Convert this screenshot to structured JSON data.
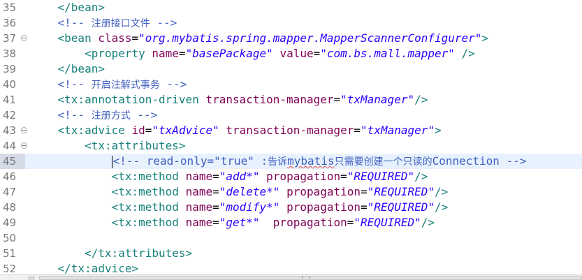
{
  "editor": {
    "lines": [
      {
        "num": "35",
        "fold": false,
        "current": false,
        "indent": "    ",
        "tokens": [
          {
            "c": "tag",
            "t": "</bean>"
          }
        ]
      },
      {
        "num": "36",
        "fold": false,
        "current": false,
        "indent": "    ",
        "tokens": [
          {
            "c": "comment",
            "t": "<!-- "
          },
          {
            "c": "comment-cjk",
            "t": "注册接口文件"
          },
          {
            "c": "comment",
            "t": " -->"
          }
        ]
      },
      {
        "num": "37",
        "fold": true,
        "current": false,
        "indent": "    ",
        "tokens": [
          {
            "c": "tag",
            "t": "<bean "
          },
          {
            "c": "attr",
            "t": "class"
          },
          {
            "c": "text",
            "t": "="
          },
          {
            "c": "val",
            "t": "\"org.mybatis.spring.mapper.MapperScannerConfigurer\""
          },
          {
            "c": "tag",
            "t": ">"
          }
        ]
      },
      {
        "num": "38",
        "fold": false,
        "current": false,
        "indent": "        ",
        "tokens": [
          {
            "c": "tag",
            "t": "<property "
          },
          {
            "c": "attr",
            "t": "name"
          },
          {
            "c": "text",
            "t": "="
          },
          {
            "c": "val",
            "t": "\"basePackage\""
          },
          {
            "c": "text",
            "t": " "
          },
          {
            "c": "attr",
            "t": "value"
          },
          {
            "c": "text",
            "t": "="
          },
          {
            "c": "val",
            "t": "\"com.bs.mall.mapper\""
          },
          {
            "c": "tag",
            "t": " />"
          }
        ]
      },
      {
        "num": "39",
        "fold": false,
        "current": false,
        "indent": "    ",
        "tokens": [
          {
            "c": "tag",
            "t": "</bean>"
          }
        ]
      },
      {
        "num": "40",
        "fold": false,
        "current": false,
        "indent": "    ",
        "tokens": [
          {
            "c": "comment",
            "t": "<!-- "
          },
          {
            "c": "comment-cjk",
            "t": "开启注解式事务"
          },
          {
            "c": "comment",
            "t": " -->"
          }
        ]
      },
      {
        "num": "41",
        "fold": false,
        "current": false,
        "indent": "    ",
        "tokens": [
          {
            "c": "tag",
            "t": "<tx:annotation-driven "
          },
          {
            "c": "attr",
            "t": "transaction-manager"
          },
          {
            "c": "text",
            "t": "="
          },
          {
            "c": "val",
            "t": "\"txManager\""
          },
          {
            "c": "tag",
            "t": "/>"
          }
        ]
      },
      {
        "num": "42",
        "fold": false,
        "current": false,
        "indent": "    ",
        "tokens": [
          {
            "c": "comment",
            "t": "<!-- "
          },
          {
            "c": "comment-cjk",
            "t": "注册方式"
          },
          {
            "c": "comment",
            "t": " -->"
          }
        ]
      },
      {
        "num": "43",
        "fold": true,
        "current": false,
        "indent": "    ",
        "tokens": [
          {
            "c": "tag",
            "t": "<tx:advice "
          },
          {
            "c": "attr",
            "t": "id"
          },
          {
            "c": "text",
            "t": "="
          },
          {
            "c": "val",
            "t": "\"txAdvice\""
          },
          {
            "c": "text",
            "t": " "
          },
          {
            "c": "attr",
            "t": "transaction-manager"
          },
          {
            "c": "text",
            "t": "="
          },
          {
            "c": "val",
            "t": "\"txManager\""
          },
          {
            "c": "tag",
            "t": ">"
          }
        ]
      },
      {
        "num": "44",
        "fold": true,
        "current": false,
        "indent": "        ",
        "tokens": [
          {
            "c": "tag",
            "t": "<tx:attributes>"
          }
        ]
      },
      {
        "num": "45",
        "fold": false,
        "current": true,
        "indent": "            ",
        "tokens": [
          {
            "c": "caret",
            "t": ""
          },
          {
            "c": "comment",
            "t": "<!-- read-only=\"true\" :"
          },
          {
            "c": "comment-cjk",
            "t": "告诉"
          },
          {
            "c": "comment-squiggle",
            "t": "mybatis"
          },
          {
            "c": "comment-cjk",
            "t": "只需要创建一个只读的"
          },
          {
            "c": "comment",
            "t": "Connection -->"
          }
        ]
      },
      {
        "num": "46",
        "fold": false,
        "current": false,
        "indent": "            ",
        "tokens": [
          {
            "c": "tag",
            "t": "<tx:method "
          },
          {
            "c": "attr",
            "t": "name"
          },
          {
            "c": "text",
            "t": "="
          },
          {
            "c": "val",
            "t": "\"add*\""
          },
          {
            "c": "text",
            "t": " "
          },
          {
            "c": "attr",
            "t": "propagation"
          },
          {
            "c": "text",
            "t": "="
          },
          {
            "c": "val",
            "t": "\"REQUIRED\""
          },
          {
            "c": "tag",
            "t": "/>"
          }
        ]
      },
      {
        "num": "47",
        "fold": false,
        "current": false,
        "indent": "            ",
        "tokens": [
          {
            "c": "tag",
            "t": "<tx:method "
          },
          {
            "c": "attr",
            "t": "name"
          },
          {
            "c": "text",
            "t": "="
          },
          {
            "c": "val",
            "t": "\"delete*\""
          },
          {
            "c": "text",
            "t": " "
          },
          {
            "c": "attr",
            "t": "propagation"
          },
          {
            "c": "text",
            "t": "="
          },
          {
            "c": "val",
            "t": "\"REQUIRED\""
          },
          {
            "c": "tag",
            "t": "/>"
          }
        ]
      },
      {
        "num": "48",
        "fold": false,
        "current": false,
        "indent": "            ",
        "tokens": [
          {
            "c": "tag",
            "t": "<tx:method "
          },
          {
            "c": "attr",
            "t": "name"
          },
          {
            "c": "text",
            "t": "="
          },
          {
            "c": "val",
            "t": "\"modify*\""
          },
          {
            "c": "text",
            "t": " "
          },
          {
            "c": "attr",
            "t": "propagation"
          },
          {
            "c": "text",
            "t": "="
          },
          {
            "c": "val",
            "t": "\"REQUIRED\""
          },
          {
            "c": "tag",
            "t": "/>"
          }
        ]
      },
      {
        "num": "49",
        "fold": false,
        "current": false,
        "indent": "            ",
        "tokens": [
          {
            "c": "tag",
            "t": "<tx:method "
          },
          {
            "c": "attr",
            "t": "name"
          },
          {
            "c": "text",
            "t": "="
          },
          {
            "c": "val",
            "t": "\"get*\""
          },
          {
            "c": "text",
            "t": "  "
          },
          {
            "c": "attr",
            "t": "propagation"
          },
          {
            "c": "text",
            "t": "="
          },
          {
            "c": "val",
            "t": "\"REQUIRED\""
          },
          {
            "c": "tag",
            "t": "/>"
          }
        ]
      },
      {
        "num": "50",
        "fold": false,
        "current": false,
        "indent": "",
        "tokens": []
      },
      {
        "num": "51",
        "fold": false,
        "current": false,
        "indent": "        ",
        "tokens": [
          {
            "c": "tag",
            "t": "</tx:attributes>"
          }
        ]
      },
      {
        "num": "52",
        "fold": false,
        "current": false,
        "indent": "    ",
        "tokens": [
          {
            "c": "tag",
            "t": "</tx:advice>"
          }
        ]
      }
    ]
  },
  "colors": {
    "tag": "#17817b",
    "attribute": "#7f0055",
    "value": "#2a00ff",
    "comment": "#3f5fbf",
    "current_line": "#e8f2fe"
  },
  "icons": {
    "fold": "fold-minus-icon"
  }
}
